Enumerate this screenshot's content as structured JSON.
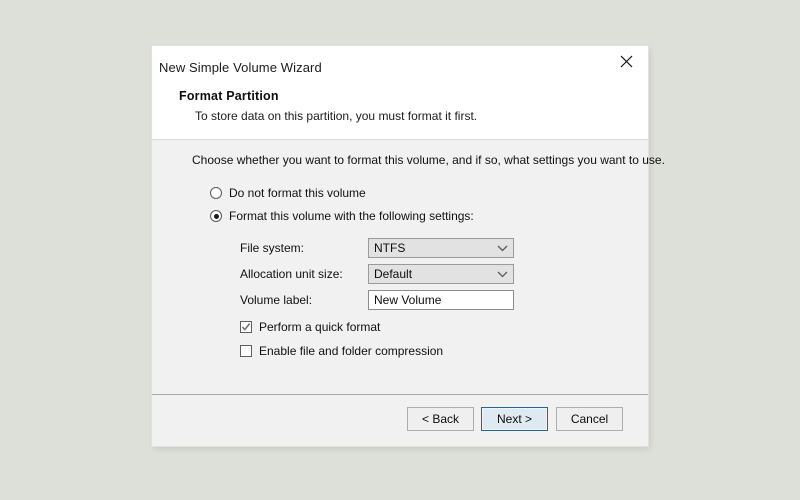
{
  "dialog": {
    "title": "New Simple Volume Wizard",
    "close_icon": "close-icon",
    "heading": "Format Partition",
    "subheading": "To store data on this partition, you must format it first.",
    "intro": "Choose whether you want to format this volume, and if so, what settings you want to use."
  },
  "options": {
    "radios": [
      {
        "label": "Do not format this volume",
        "checked": false
      },
      {
        "label": "Format this volume with the following settings:",
        "checked": true
      }
    ],
    "fields": [
      {
        "label": "File system:",
        "type": "combobox",
        "value": "NTFS",
        "icon": "chevron-down-icon"
      },
      {
        "label": "Allocation unit size:",
        "type": "combobox",
        "value": "Default",
        "icon": "chevron-down-icon"
      },
      {
        "label": "Volume label:",
        "type": "textbox",
        "value": "New Volume",
        "placeholder": ""
      }
    ],
    "checkboxes": [
      {
        "label": "Perform a quick format",
        "checked": true
      },
      {
        "label": "Enable file and folder compression",
        "checked": false
      }
    ]
  },
  "footer": {
    "back_label": "< Back",
    "next_label": "Next >",
    "cancel_label": "Cancel"
  },
  "colors": {
    "page_background": "#dde0d8",
    "dialog_header": "#ffffff",
    "dialog_body": "#f1f1f1",
    "focus_border": "#1d6a8c",
    "focus_fill": "#dfe9f1",
    "combo_fill": "#e2e2e2",
    "textbox_fill": "#ffffff"
  }
}
